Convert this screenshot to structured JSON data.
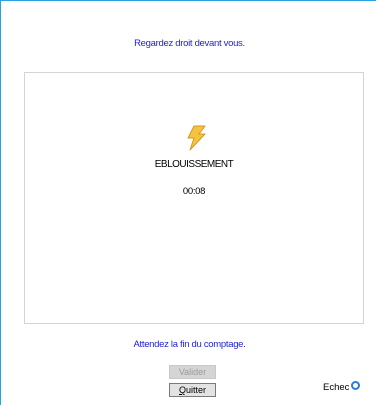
{
  "instruction": "Regardez droit devant vous.",
  "test": {
    "icon": "lightning-bolt-icon",
    "name": "EBLOUISSEMENT",
    "timer": "00:08"
  },
  "status": "Attendez la fin du comptage.",
  "buttons": {
    "validate_label": "Valider",
    "quit_label_mnemonic": "Q",
    "quit_label_rest": "uitter"
  },
  "result": {
    "label": "Echec",
    "indicator_icon": "status-ring-icon",
    "indicator_color": "#2b7cd6"
  },
  "colors": {
    "frame_border": "#29a3e0",
    "message_text": "#1f1fd6",
    "bolt_fill": "#f5c242"
  }
}
